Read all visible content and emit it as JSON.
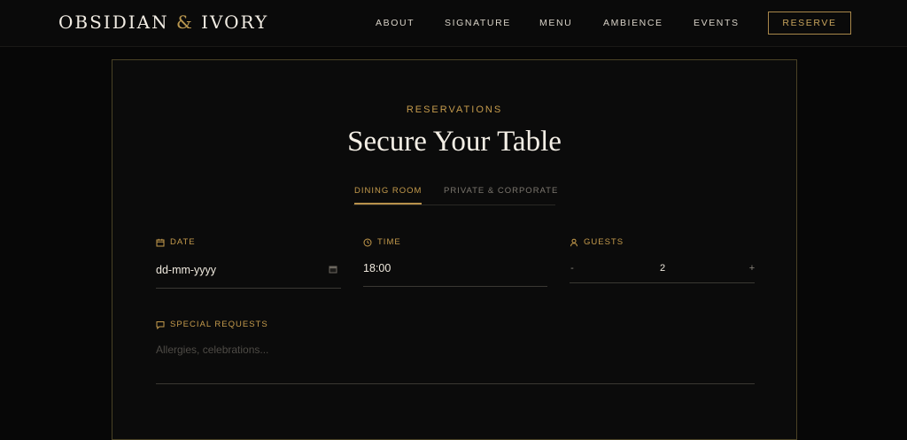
{
  "brand": {
    "name_left": "OBSIDIAN",
    "ampersand": "&",
    "name_right": "IVORY"
  },
  "nav": {
    "items": [
      {
        "label": "ABOUT"
      },
      {
        "label": "SIGNATURE"
      },
      {
        "label": "MENU"
      },
      {
        "label": "AMBIENCE"
      },
      {
        "label": "EVENTS"
      }
    ],
    "reserve_label": "RESERVE"
  },
  "reservation": {
    "eyebrow": "RESERVATIONS",
    "title": "Secure Your Table",
    "tabs": [
      {
        "label": "DINING ROOM",
        "active": true
      },
      {
        "label": "PRIVATE & CORPORATE",
        "active": false
      }
    ],
    "date": {
      "label": "DATE",
      "value": "dd-mm-yyyy"
    },
    "time": {
      "label": "TIME",
      "value": "18:00"
    },
    "guests": {
      "label": "GUESTS",
      "minus": "-",
      "plus": "+",
      "value": "2"
    },
    "requests": {
      "label": "SPECIAL REQUESTS",
      "placeholder": "Allergies, celebrations..."
    }
  },
  "colors": {
    "background": "#070707",
    "accent_gold": "#c59b4c",
    "text_ivory": "#f4efe6"
  },
  "icons": {
    "date": "calendar-icon",
    "time": "clock-icon",
    "guests": "user-icon",
    "requests": "message-icon",
    "date_picker": "calendar-picker-icon"
  }
}
